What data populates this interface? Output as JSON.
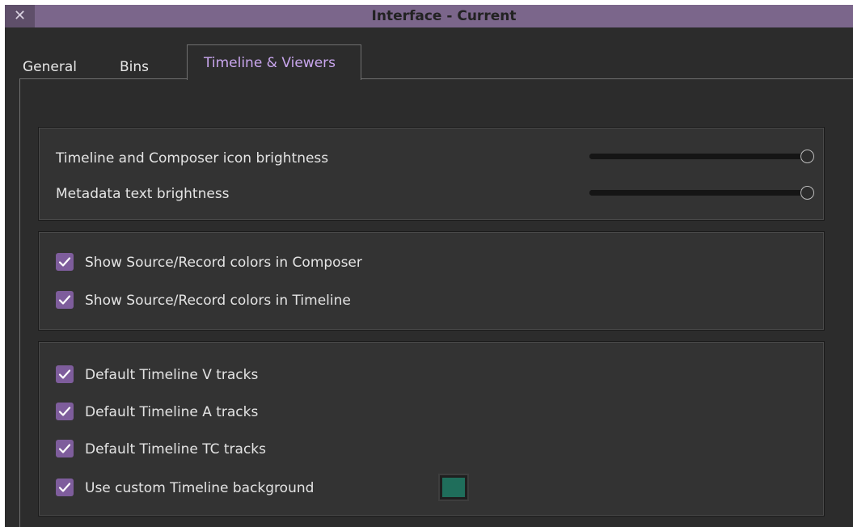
{
  "window": {
    "title": "Interface - Current",
    "close_glyph": "✕"
  },
  "tabs": [
    {
      "label": "General",
      "active": false
    },
    {
      "label": "Bins",
      "active": false
    },
    {
      "label": "Timeline & Viewers",
      "active": true
    }
  ],
  "sliders": [
    {
      "label": "Timeline and Composer icon brightness",
      "level": 1.0
    },
    {
      "label": "Metadata text brightness",
      "level": 1.0
    }
  ],
  "color_checkboxes": [
    {
      "label": "Show Source/Record colors in Composer",
      "checked": true
    },
    {
      "label": "Show Source/Record colors in Timeline",
      "checked": true
    }
  ],
  "timeline_checkboxes": [
    {
      "label": "Default Timeline V tracks",
      "checked": true
    },
    {
      "label": "Default Timeline A tracks",
      "checked": true
    },
    {
      "label": "Default Timeline TC tracks",
      "checked": true
    },
    {
      "label": "Use custom Timeline background",
      "checked": true
    }
  ],
  "colors": {
    "accent": "#c9a6ee",
    "titlebar": "#7b668b",
    "checkbox": "#7e5d9c",
    "timeline_background": "#1f6e5b"
  }
}
